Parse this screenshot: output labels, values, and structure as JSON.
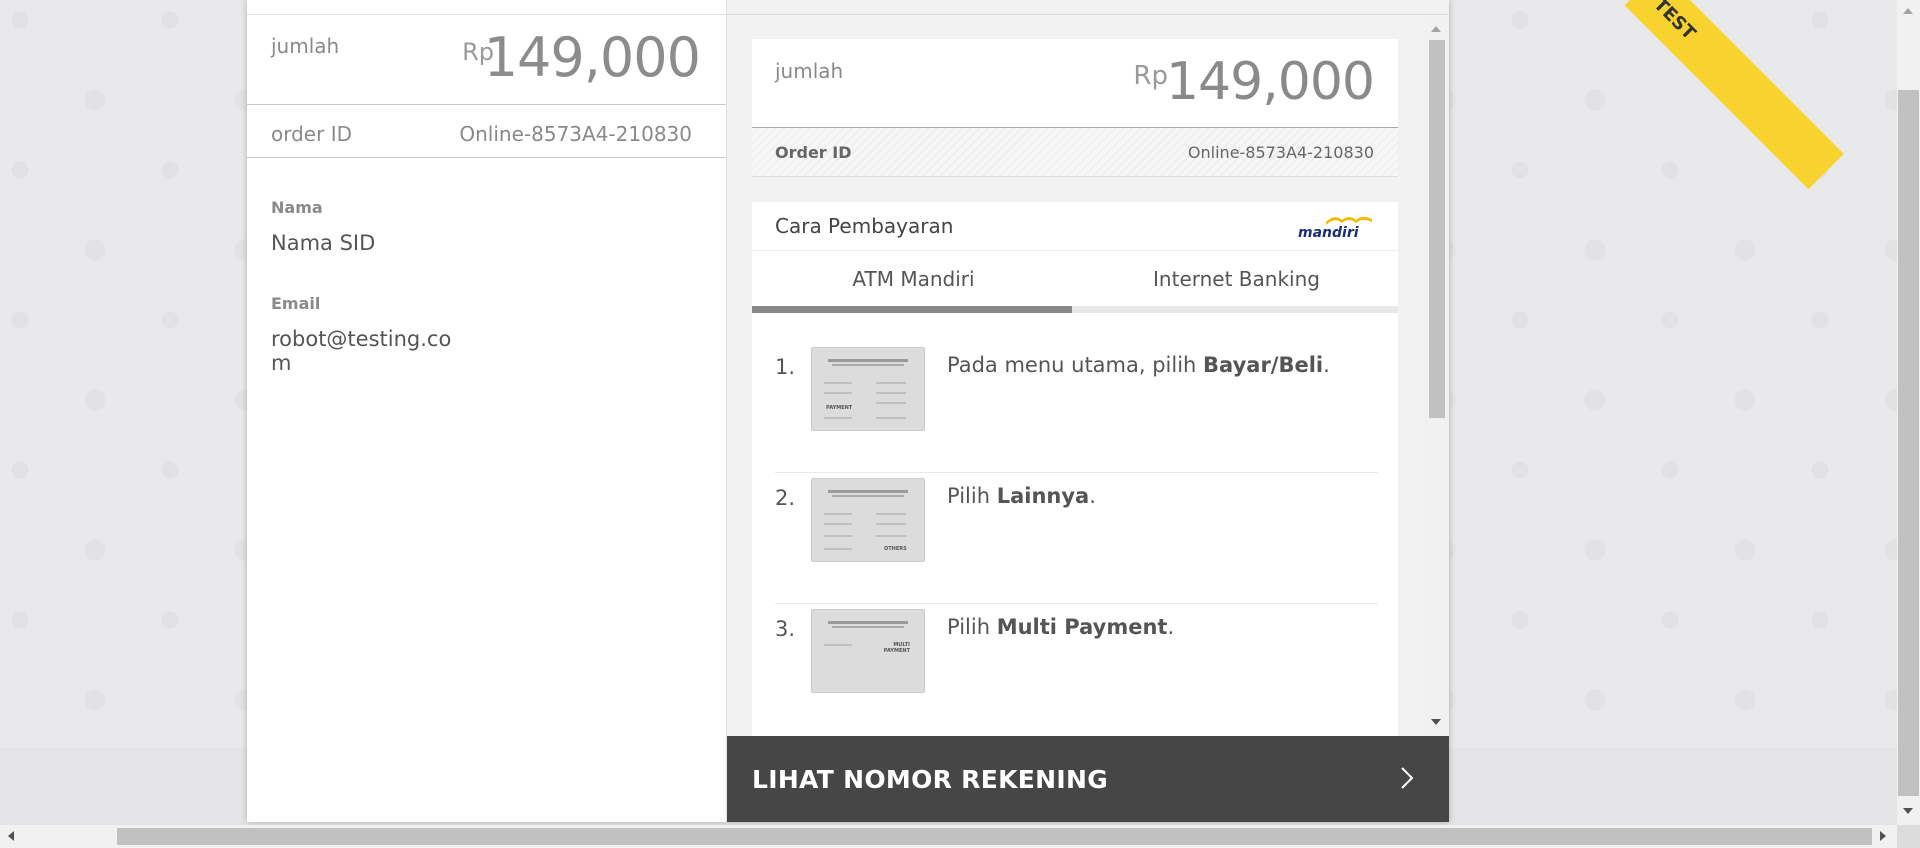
{
  "ribbon": {
    "label": "TEST"
  },
  "summary": {
    "amount_label": "jumlah",
    "currency": "Rp",
    "amount": "149,000",
    "order_label": "order ID",
    "order_id": "Online-8573A4-210830",
    "name_label": "Nama",
    "name_value": "Nama SID",
    "email_label": "Email",
    "email_value": "robot@testing.com"
  },
  "payment_panel": {
    "amount_label": "jumlah",
    "currency": "Rp",
    "amount": "149,000",
    "order_label": "Order ID",
    "order_id": "Online-8573A4-210830",
    "method_title": "Cara Pembayaran",
    "bank_logo": "mandiri",
    "tabs": [
      {
        "label": "ATM Mandiri",
        "active": true
      },
      {
        "label": "Internet Banking",
        "active": false
      }
    ],
    "steps": [
      {
        "number": "1.",
        "text_before": "Pada menu utama, pilih ",
        "bold": "Bayar/Beli",
        "text_after": ".",
        "thumb_tag": "PAYMENT"
      },
      {
        "number": "2.",
        "text_before": "Pilih ",
        "bold": "Lainnya",
        "text_after": ".",
        "thumb_tag": "OTHERS"
      },
      {
        "number": "3.",
        "text_before": "Pilih ",
        "bold": "Multi Payment",
        "text_after": ".",
        "thumb_tag": "MULTI PAYMENT"
      }
    ],
    "cta_label": "LIHAT NOMOR REKENING"
  },
  "colors": {
    "ribbon": "#f8d32f",
    "cta_bg": "#464646",
    "tab_active": "#888888",
    "mandiri_blue": "#1b2f7a",
    "mandiri_gold": "#f5b800"
  }
}
